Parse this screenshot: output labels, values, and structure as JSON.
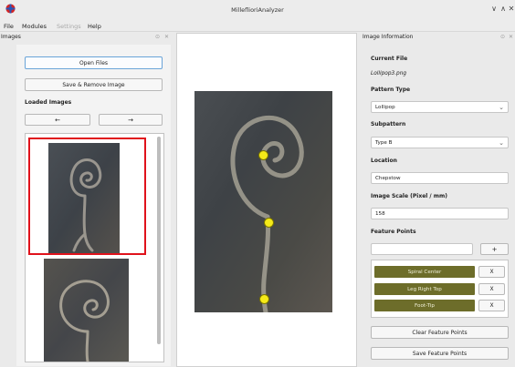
{
  "window": {
    "title": "MilleflioriAnalyzer",
    "controls": [
      "∨",
      "∧",
      "✕"
    ]
  },
  "menu": [
    {
      "label": "File",
      "enabled": true
    },
    {
      "label": "Modules",
      "enabled": true
    },
    {
      "label": "Settings",
      "enabled": false
    },
    {
      "label": "Help",
      "enabled": true
    }
  ],
  "images_panel": {
    "title": "Images",
    "open_files": "Open Files",
    "save_remove": "Save & Remove Image",
    "loaded_label": "Loaded Images",
    "prev": "←",
    "next": "→"
  },
  "info_panel": {
    "title": "Image Information",
    "current_file_label": "Current File",
    "current_file": "Lollipop3.png",
    "pattern_type_label": "Pattern Type",
    "pattern_type": "Lollipop",
    "subpattern_label": "Subpattern",
    "subpattern": "Type B",
    "location_label": "Location",
    "location": "Chepstow",
    "scale_label": "Image Scale (Pixel / mm)",
    "scale": "158",
    "feature_points_label": "Feature Points",
    "feature_input": "",
    "add": "+",
    "features": [
      {
        "label": "Spiral Center",
        "remove": "X"
      },
      {
        "label": "Leg Right Top",
        "remove": "X"
      },
      {
        "label": "Foot-Tip",
        "remove": "X"
      }
    ],
    "clear": "Clear Feature Points",
    "save": "Save Feature Points"
  },
  "panel_icons": {
    "float": "⊙",
    "close": "✕"
  },
  "colors": {
    "feature_button": "#6d6d2a",
    "point": "#f5ea18",
    "selection": "#e0121b"
  }
}
